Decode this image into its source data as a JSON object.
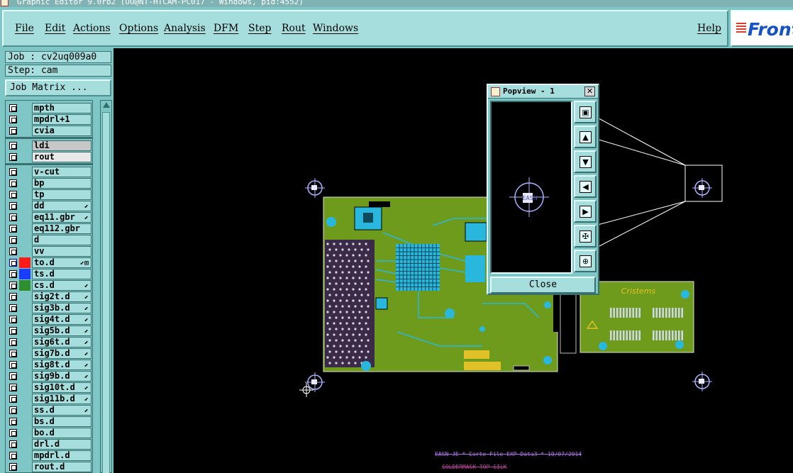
{
  "window": {
    "title": "Graphic Editor 9.0rb2 (UU@NT-HTCAM-PC017 - Windows, pid:4552)"
  },
  "menu": {
    "items": [
      "File",
      "Edit",
      "Actions",
      "Options",
      "Analysis",
      "DFM",
      "Step",
      "Rout",
      "Windows"
    ],
    "help": "Help",
    "logo": "Frontline"
  },
  "job": {
    "job_label": "Job : cv2uq009a0",
    "step_label": "Step: cam",
    "matrix_button": "Job Matrix ..."
  },
  "layers": [
    {
      "name": "mpth",
      "color": null,
      "affected": false
    },
    {
      "name": "mpdrl+1",
      "color": null,
      "affected": false
    },
    {
      "name": "cvia",
      "color": null,
      "affected": false
    },
    {
      "name": "ldi",
      "color": null,
      "affected": false,
      "style": "gray"
    },
    {
      "name": "rout",
      "color": null,
      "affected": false,
      "style": "white"
    },
    {
      "name": "v-cut",
      "color": null,
      "affected": false
    },
    {
      "name": "bp",
      "color": null,
      "affected": false
    },
    {
      "name": "tp",
      "color": null,
      "affected": false
    },
    {
      "name": "dd",
      "color": null,
      "affected": false,
      "mark": "⬋"
    },
    {
      "name": "eq11.gbr",
      "color": null,
      "affected": false,
      "mark": "⬋"
    },
    {
      "name": "eq112.gbr",
      "color": null,
      "affected": false
    },
    {
      "name": "d",
      "color": null,
      "affected": false
    },
    {
      "name": "vv",
      "color": null,
      "affected": false
    },
    {
      "name": "to.d",
      "color": "#ff1a1a",
      "affected": true,
      "mark": "⬋⊞"
    },
    {
      "name": "ts.d",
      "color": "#1a3cff",
      "affected": false
    },
    {
      "name": "cs.d",
      "color": "#2f8f2f",
      "affected": false,
      "mark": "⬋"
    },
    {
      "name": "sig2t.d",
      "color": null,
      "affected": false,
      "mark": "⬋"
    },
    {
      "name": "sig3b.d",
      "color": null,
      "affected": false,
      "mark": "⬋"
    },
    {
      "name": "sig4t.d",
      "color": null,
      "affected": false,
      "mark": "⬋"
    },
    {
      "name": "sig5b.d",
      "color": null,
      "affected": false,
      "mark": "⬋"
    },
    {
      "name": "sig6t.d",
      "color": null,
      "affected": false,
      "mark": "⬋"
    },
    {
      "name": "sig7b.d",
      "color": null,
      "affected": false,
      "mark": "⬋"
    },
    {
      "name": "sig8t.d",
      "color": null,
      "affected": false,
      "mark": "⬋"
    },
    {
      "name": "sig9b.d",
      "color": null,
      "affected": false,
      "mark": "⬋"
    },
    {
      "name": "sig10t.d",
      "color": null,
      "affected": false,
      "mark": "⬋"
    },
    {
      "name": "sig11b.d",
      "color": null,
      "affected": false,
      "mark": "⬋"
    },
    {
      "name": "ss.d",
      "color": null,
      "affected": false,
      "mark": "⬋"
    },
    {
      "name": "bs.d",
      "color": null,
      "affected": false
    },
    {
      "name": "bo.d",
      "color": null,
      "affected": false
    },
    {
      "name": "drl.d",
      "color": null,
      "affected": false
    },
    {
      "name": "mpdrl.d",
      "color": null,
      "affected": false
    },
    {
      "name": "rout.d",
      "color": null,
      "affected": false
    }
  ],
  "popview": {
    "title": "Popview - 1",
    "close_x": "✕",
    "close_button": "Close",
    "buttons": [
      "zoom-fit",
      "pan-up",
      "pan-down",
      "pan-left",
      "pan-right",
      "zoom-out",
      "zoom-in"
    ],
    "center_label": "EASN"
  },
  "canvas": {
    "footer_line1": "EASN JE * Carte File EXP Data3 * 10/07/2014",
    "footer_line2": "SOLDERMASK TOP SILK",
    "board_logo": "Cristems"
  },
  "colors": {
    "panel": "#7fc6c6",
    "panel_light": "#a6dede",
    "board_green": "#6f9b1c",
    "board_cyan": "#2ab7dd",
    "footer_text": "#ad6fe8"
  }
}
